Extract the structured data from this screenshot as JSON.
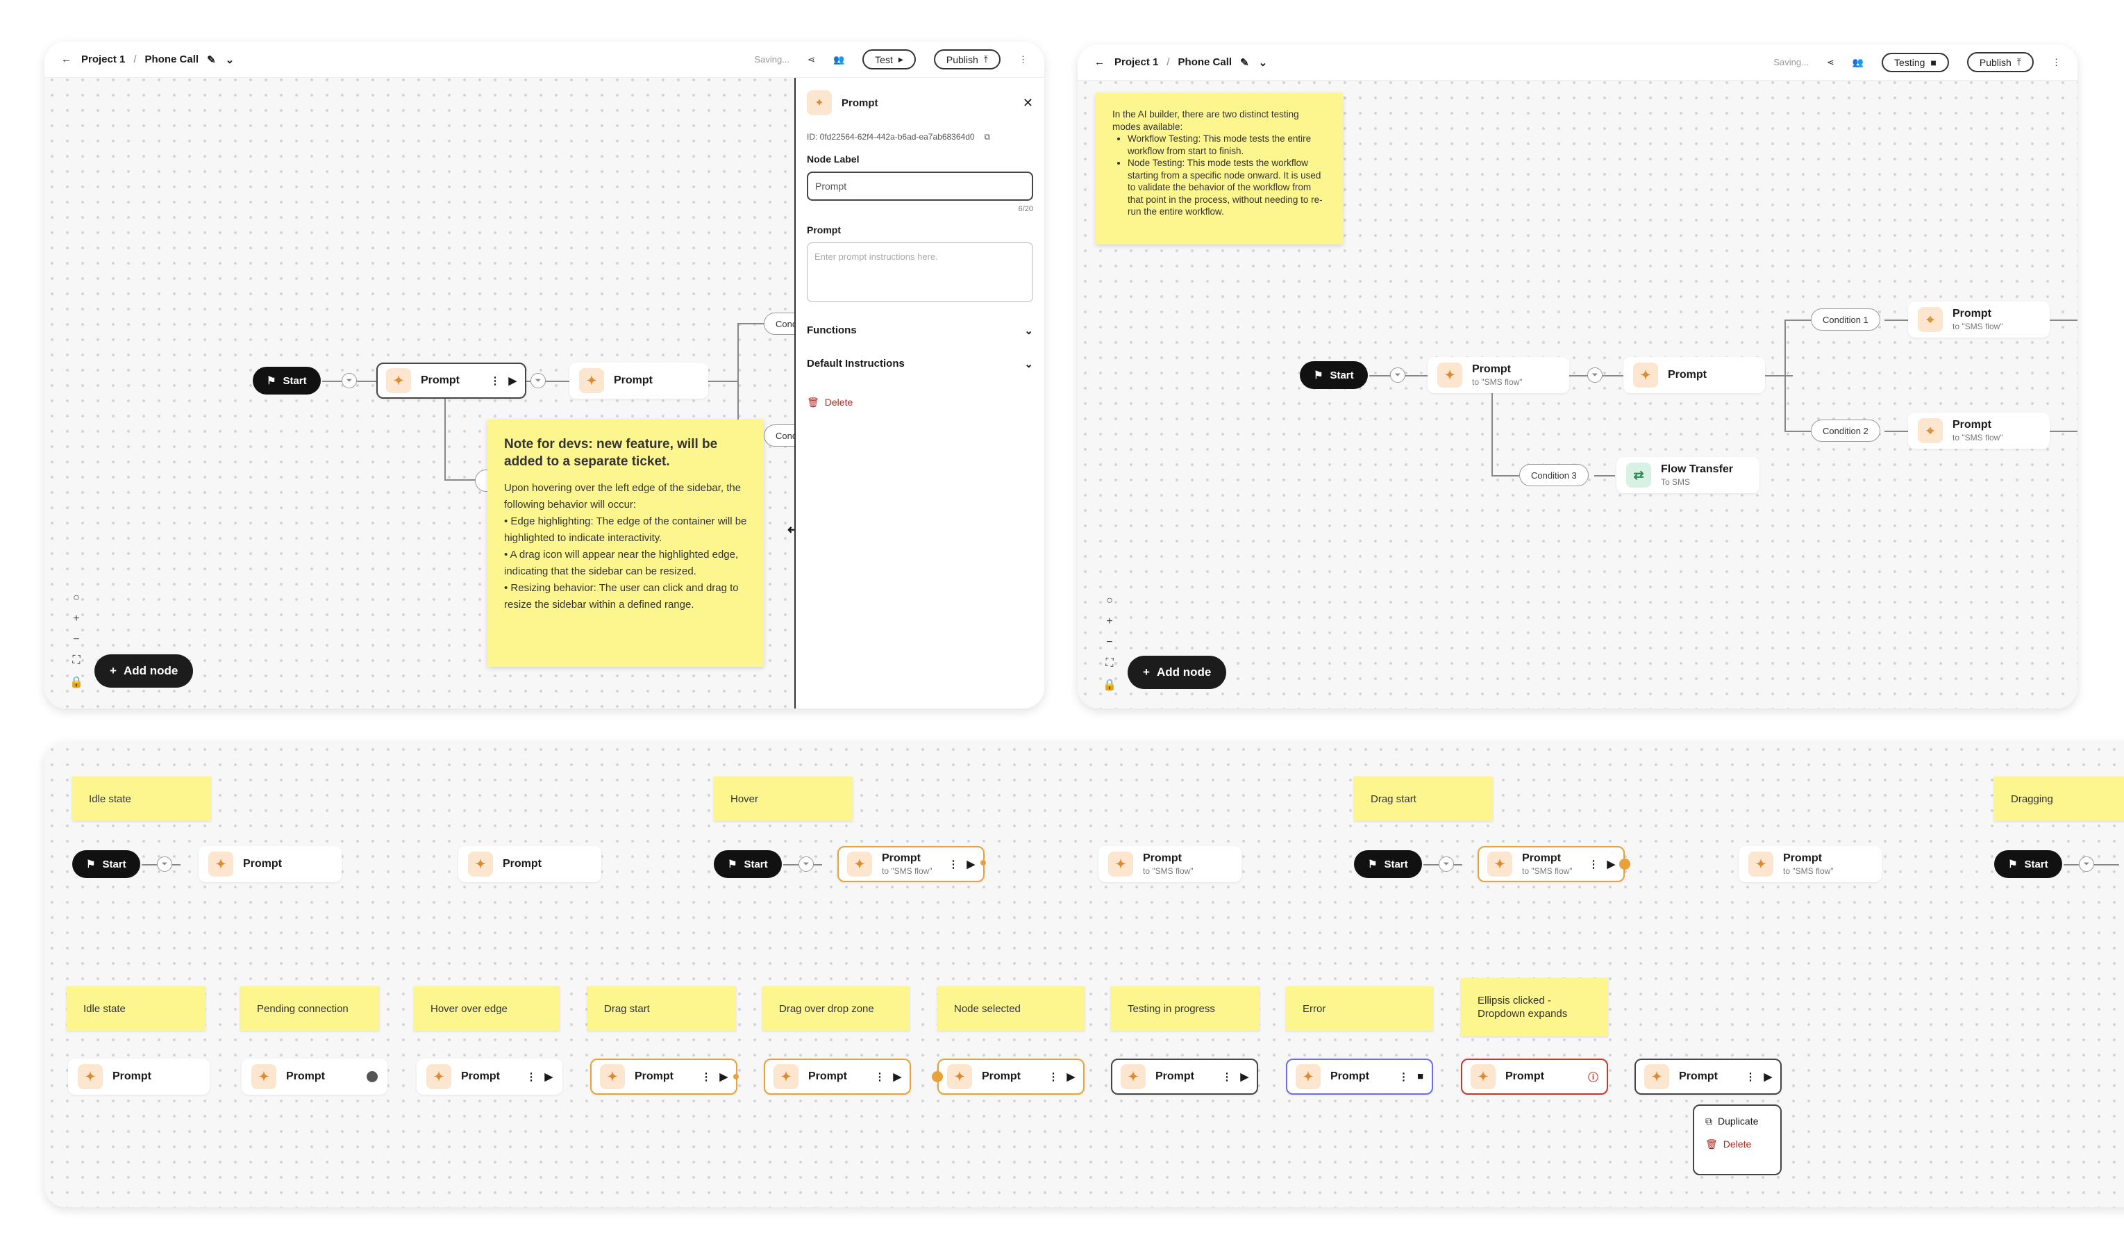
{
  "left": {
    "breadcrumb": {
      "project": "Project 1",
      "page": "Phone Call"
    },
    "saving": "Saving...",
    "test_label": "Test",
    "publish_label": "Publish",
    "start_label": "Start",
    "prompt_label": "Prompt",
    "cond_label": "Cond",
    "add_node": "Add node",
    "note": {
      "title": "Note for devs: new feature, will be added to a separate ticket.",
      "body": "Upon hovering over the left edge of the sidebar, the following behavior will occur:",
      "bullets": [
        "• Edge highlighting: The edge of the container will be highlighted to indicate interactivity.",
        "• A drag icon will appear near the highlighted edge, indicating that the sidebar can be resized.",
        "• Resizing behavior: The user can click and drag to resize the sidebar within a defined range."
      ]
    },
    "sidebar": {
      "title": "Prompt",
      "id": "ID: 0fd22564-62f4-442a-b6ad-ea7ab68364d0",
      "node_label": "Node Label",
      "node_value": "Prompt",
      "counter": "6/20",
      "prompt_label": "Prompt",
      "prompt_placeholder": "Enter prompt instructions here.",
      "functions": "Functions",
      "default_instructions": "Default Instructions",
      "delete": "Delete"
    }
  },
  "right": {
    "breadcrumb": {
      "project": "Project 1",
      "page": "Phone Call"
    },
    "saving": "Saving...",
    "testing_label": "Testing",
    "publish_label": "Publish",
    "note": {
      "intro": "In the AI builder, there are two distinct testing modes available:",
      "bullets": [
        "Workflow Testing: This mode tests the entire workflow from start to finish.",
        "Node Testing: This mode tests the workflow starting from a specific node onward. It is used to validate the behavior of the workflow from that point in the process, without needing to re-run the entire workflow."
      ]
    },
    "start_label": "Start",
    "prompt_label": "Prompt",
    "sms_sub": "to \"SMS flow\"",
    "condition1": "Condition 1",
    "condition2": "Condition 2",
    "condition3": "Condition 3",
    "flow_transfer": "Flow Transfer",
    "flow_transfer_sub": "To SMS",
    "add_node": "Add node"
  },
  "bottom": {
    "row1_labels": [
      "Idle state",
      "Hover",
      "Drag start",
      "Dragging"
    ],
    "row2_labels": [
      "Idle state",
      "Pending connection",
      "Hover over edge",
      "Drag start",
      "Drag over drop zone",
      "Node selected",
      "Testing in progress",
      "Error",
      "Ellipsis clicked - Dropdown expands"
    ],
    "start_label": "Start",
    "prompt_label": "Prompt",
    "sms_sub": "to \"SMS flow\"",
    "menu": {
      "duplicate": "Duplicate",
      "delete": "Delete"
    }
  },
  "colors": {
    "accent_orange": "#e7a23a",
    "error_red": "#c0392b",
    "testing_blue": "#6b6ee0",
    "sticky": "#fdf68f"
  }
}
